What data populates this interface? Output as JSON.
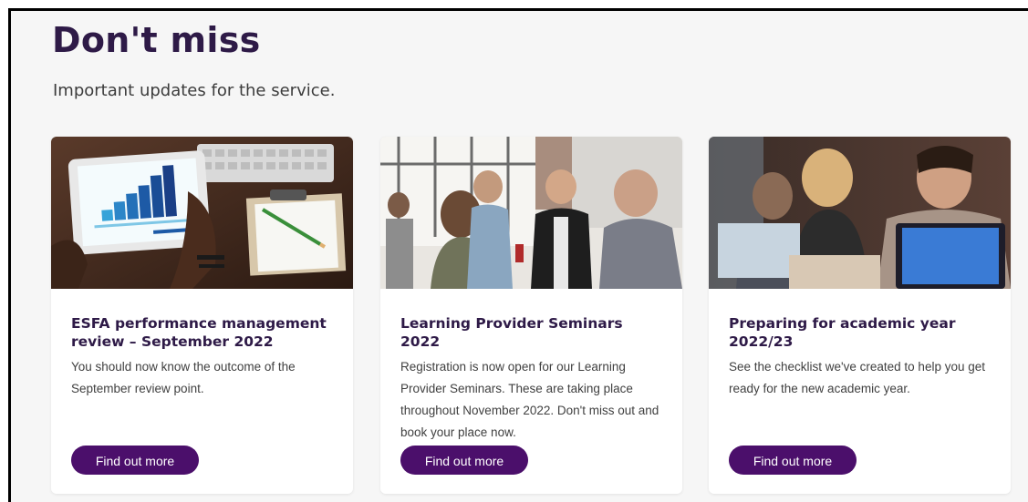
{
  "section": {
    "title": "Don't miss",
    "subtitle": "Important updates for the service."
  },
  "cards": [
    {
      "title": "ESFA performance management review – September 2022",
      "text": "You should now know the outcome of the September review point.",
      "button_label": "Find out more",
      "image": "tablet-bar-chart-photo"
    },
    {
      "title": "Learning Provider Seminars 2022",
      "text": "Registration is now open for our Learning Provider Seminars. These are taking place throughout November 2022. Don't miss out and book your place now.",
      "button_label": "Find out more",
      "image": "networking-event-photo"
    },
    {
      "title": "Preparing for academic year 2022/23",
      "text": "See the checklist we've created to help you get ready for the new academic year.",
      "button_label": "Find out more",
      "image": "student-laptop-photo"
    }
  ],
  "colors": {
    "heading": "#2e1a47",
    "button": "#4b0f6b",
    "background": "#f6f6f6"
  }
}
